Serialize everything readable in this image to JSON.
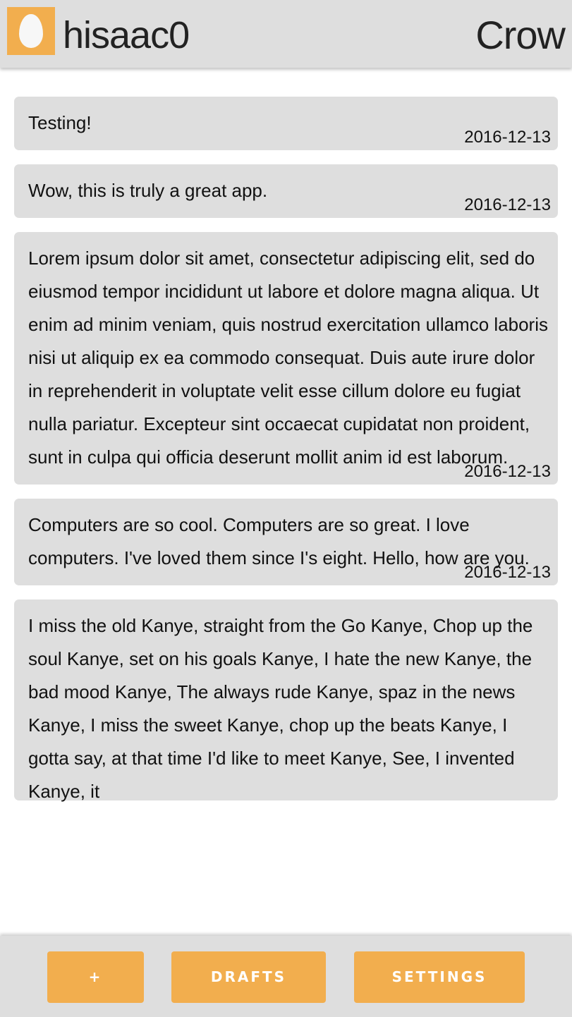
{
  "header": {
    "username": "hisaac0",
    "app_name": "Crow",
    "avatar_icon": "egg-icon",
    "avatar_color": "#f2ae4e"
  },
  "posts": [
    {
      "text": "Testing!",
      "date": "2016-12-13"
    },
    {
      "text": "Wow, this is truly a great app.",
      "date": "2016-12-13"
    },
    {
      "text": "Lorem ipsum dolor sit amet, consectetur adipiscing elit, sed do eiusmod tempor incididunt ut labore et dolore magna aliqua. Ut enim ad minim veniam, quis nostrud exercitation ullamco laboris nisi ut aliquip ex ea commodo consequat. Duis aute irure dolor in reprehenderit in voluptate velit esse cillum dolore eu fugiat nulla pariatur. Excepteur sint occaecat cupidatat non proident, sunt in culpa qui officia deserunt mollit anim id est laborum.",
      "date": "2016-12-13"
    },
    {
      "text": "Computers are so cool. Computers are so great. I love computers. I've loved them since I's eight. Hello, how are you.",
      "date": "2016-12-13"
    },
    {
      "text": "I miss the old Kanye, straight from the Go Kanye, Chop up the soul Kanye, set on his goals Kanye, I hate the new Kanye, the bad mood Kanye, The always rude Kanye, spaz in the news Kanye, I miss the sweet Kanye, chop up the beats Kanye, I gotta say, at that time I'd like to meet Kanye, See, I invented Kanye, it",
      "date": ""
    }
  ],
  "footer": {
    "add_label": "+",
    "drafts_label": "DRAFTS",
    "settings_label": "SETTINGS"
  },
  "colors": {
    "accent": "#f2ae4e",
    "card_background": "#dedede",
    "bar_background": "#dedede"
  }
}
